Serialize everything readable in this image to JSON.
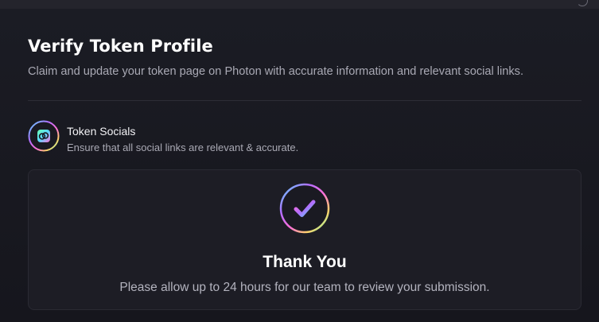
{
  "page": {
    "title": "Verify Token Profile",
    "subtitle": "Claim and update your token page on Photon with accurate information and relevant social links."
  },
  "section": {
    "icon": "link-icon",
    "title": "Token Socials",
    "description": "Ensure that all social links are relevant & accurate."
  },
  "confirmation": {
    "icon": "checkmark-icon",
    "title": "Thank You",
    "message": "Please allow up to 24 hours for our team to review your submission."
  },
  "colors": {
    "background": "#15151c",
    "card": "#1d1d25",
    "gradient": [
      "#5ad8ff",
      "#b26dff",
      "#ff6fd8",
      "#ffd36a",
      "#6cffb0"
    ]
  }
}
